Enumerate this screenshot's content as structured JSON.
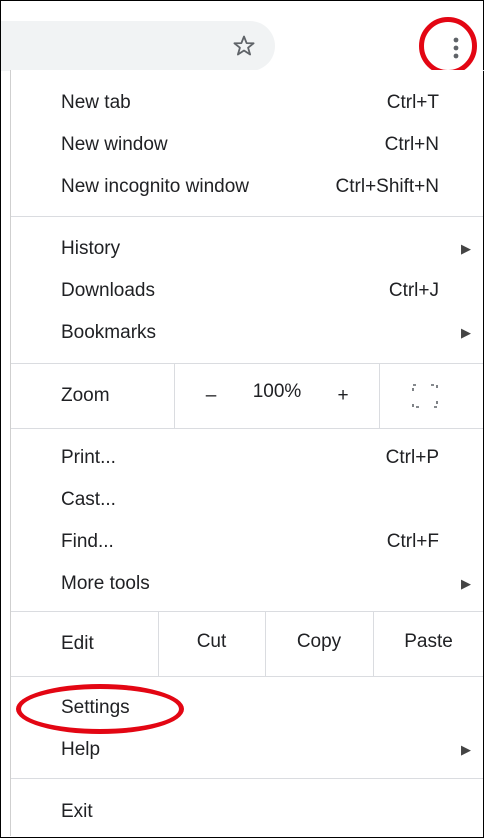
{
  "toolbar": {
    "star_icon": "star-icon",
    "menu_icon": "vertical-dots-icon"
  },
  "menu": {
    "group1": [
      {
        "label": "New tab",
        "shortcut": "Ctrl+T"
      },
      {
        "label": "New window",
        "shortcut": "Ctrl+N"
      },
      {
        "label": "New incognito window",
        "shortcut": "Ctrl+Shift+N"
      }
    ],
    "group2": [
      {
        "label": "History",
        "submenu": true
      },
      {
        "label": "Downloads",
        "shortcut": "Ctrl+J"
      },
      {
        "label": "Bookmarks",
        "submenu": true
      }
    ],
    "zoom": {
      "label": "Zoom",
      "minus": "–",
      "value": "100%",
      "plus": "+",
      "fullscreen_icon": "fullscreen-icon"
    },
    "group3": [
      {
        "label": "Print...",
        "shortcut": "Ctrl+P"
      },
      {
        "label": "Cast..."
      },
      {
        "label": "Find...",
        "shortcut": "Ctrl+F"
      },
      {
        "label": "More tools",
        "submenu": true
      }
    ],
    "edit": {
      "label": "Edit",
      "cut": "Cut",
      "copy": "Copy",
      "paste": "Paste"
    },
    "group4": [
      {
        "label": "Settings"
      },
      {
        "label": "Help",
        "submenu": true
      }
    ],
    "exit": {
      "label": "Exit"
    }
  },
  "highlight_color": "#e30613"
}
